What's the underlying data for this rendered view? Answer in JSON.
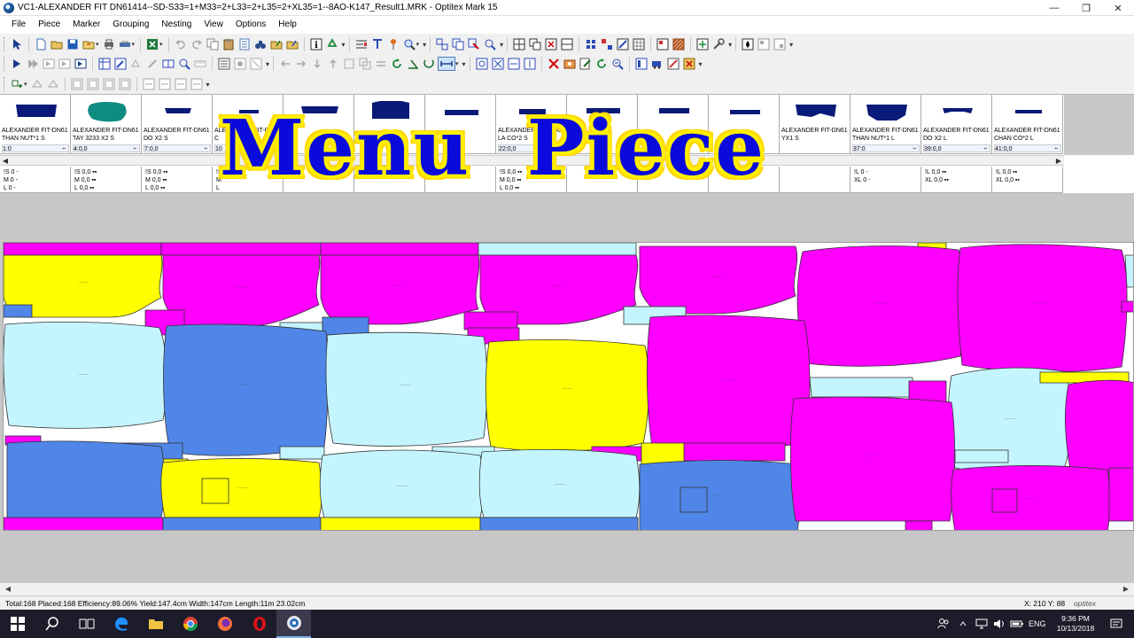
{
  "window": {
    "title": "VC1-ALEXANDER  FIT DN61414--SD-S33=1+M33=2+L33=2+L35=2+XL35=1--8AO-K147_Result1.MRK - Optitex Mark 15",
    "app_icon": "optitex-logo-icon",
    "controls": [
      "minimize-icon",
      "restore-icon",
      "close-icon"
    ]
  },
  "menu": [
    "File",
    "Piece",
    "Marker",
    "Grouping",
    "Nesting",
    "View",
    "Options",
    "Help"
  ],
  "overlay_title": "Menu  Piece",
  "pieces": [
    {
      "name1": "ALEXANDER FIT-DN61",
      "name2": "THAN NUT*1 S",
      "count": "1:0",
      "color": "#0a1a78"
    },
    {
      "name1": "ALEXANDER FIT-DN61",
      "name2": "TAY 3233 X2 S",
      "count": "4:0,0",
      "color": "#0e8c82"
    },
    {
      "name1": "ALEXANDER FIT-DN61",
      "name2": "DO X2 S",
      "count": "7:0,0",
      "color": "#0a1a78"
    },
    {
      "name1": "ALEXANDER FIT-DN61",
      "name2": "C",
      "count": "10",
      "color": "#0a1a78"
    },
    {
      "name1": "",
      "name2": "",
      "count": "",
      "color": "#0a1a78"
    },
    {
      "name1": "",
      "name2": "",
      "count": "",
      "color": "#0a1a78"
    },
    {
      "name1": "",
      "name2": "",
      "count": "",
      "color": "#0a1a78"
    },
    {
      "name1": "ALEXANDER FIT-DN61",
      "name2": "LA CO*2 S",
      "count": "22:0,0",
      "color": "#0a1a78"
    },
    {
      "name1": "",
      "name2": "",
      "count": "",
      "color": "#0a1a78"
    },
    {
      "name1": "",
      "name2": "",
      "count": "",
      "color": "#0a1a78"
    },
    {
      "name1": "",
      "name2": "",
      "count": "",
      "color": "#0a1a78"
    },
    {
      "name1": "ALEXANDER FIT-DN61",
      "name2": "YX1 S",
      "count": "",
      "color": "#0a1a78"
    },
    {
      "name1": "ALEXANDER FIT-DN61",
      "name2": "THAN NUT*1 L",
      "count": "37:0",
      "color": "#0a1a78"
    },
    {
      "name1": "ALEXANDER FIT-DN61",
      "name2": "DO X2 L",
      "count": "39:0,0",
      "color": "#0a1a78"
    },
    {
      "name1": "ALEXANDER FIT-DN61",
      "name2": "CHAN CO*2 L",
      "count": "41:0,0",
      "color": "#0a1a78"
    }
  ],
  "size_boxes": [
    {
      "lines": [
        "!S  0  -",
        "M  0  -",
        "L  0  -"
      ]
    },
    {
      "lines": [
        "!S  0,0 ▪▪",
        "M  0,0 ▪▪",
        "L  0,0 ▪▪"
      ]
    },
    {
      "lines": [
        "!S  0,0 ▪▪",
        "M  0,0 ▪▪",
        "L  0,0 ▪▪"
      ]
    },
    {
      "lines": [
        "!S",
        "M",
        "L"
      ]
    },
    {
      "lines": [
        "",
        "",
        ""
      ]
    },
    {
      "lines": [
        "",
        "",
        ""
      ]
    },
    {
      "lines": [
        "",
        "",
        ""
      ]
    },
    {
      "lines": [
        "!S  0,0 ▪▪",
        "M  0,0 ▪▪",
        "L  0,0 ▪▪"
      ]
    },
    {
      "lines": [
        "",
        "",
        ""
      ]
    },
    {
      "lines": [
        "",
        "",
        ""
      ]
    },
    {
      "lines": [
        "",
        "",
        ""
      ]
    },
    {
      "lines": [
        "",
        "",
        ""
      ]
    },
    {
      "lines": [
        "!L  0  -",
        "XL  0  -",
        ""
      ]
    },
    {
      "lines": [
        "!L  0,0 ▪▪",
        "XL  0,0 ▪▪",
        ""
      ]
    },
    {
      "lines": [
        "!L  0,0 ▪▪",
        "XL  0,0 ▪▪",
        ""
      ]
    }
  ],
  "status": {
    "stats": "Total:168  Placed:168  Efficiency:89.06%  Yield:147.4cm  Width:147cm  Length:11m 23.02cm",
    "coords": "X: 210  Y: 88",
    "brand": "optitex"
  },
  "taskbar": {
    "apps": [
      "windows-start-icon",
      "search-icon",
      "task-view-icon",
      "edge-icon",
      "file-explorer-icon",
      "chrome-icon",
      "firefox-icon",
      "opera-icon",
      "optitex-app-icon"
    ],
    "lang": "ENG",
    "time": "9:36 PM",
    "date": "10/13/2018"
  },
  "colors": {
    "magenta": "#ff00ff",
    "yellow": "#ffff00",
    "light_blue": "#c4f5ff",
    "blue": "#4f86e8",
    "title_blue": "#0a0adc",
    "title_yellow": "#ffef00"
  }
}
